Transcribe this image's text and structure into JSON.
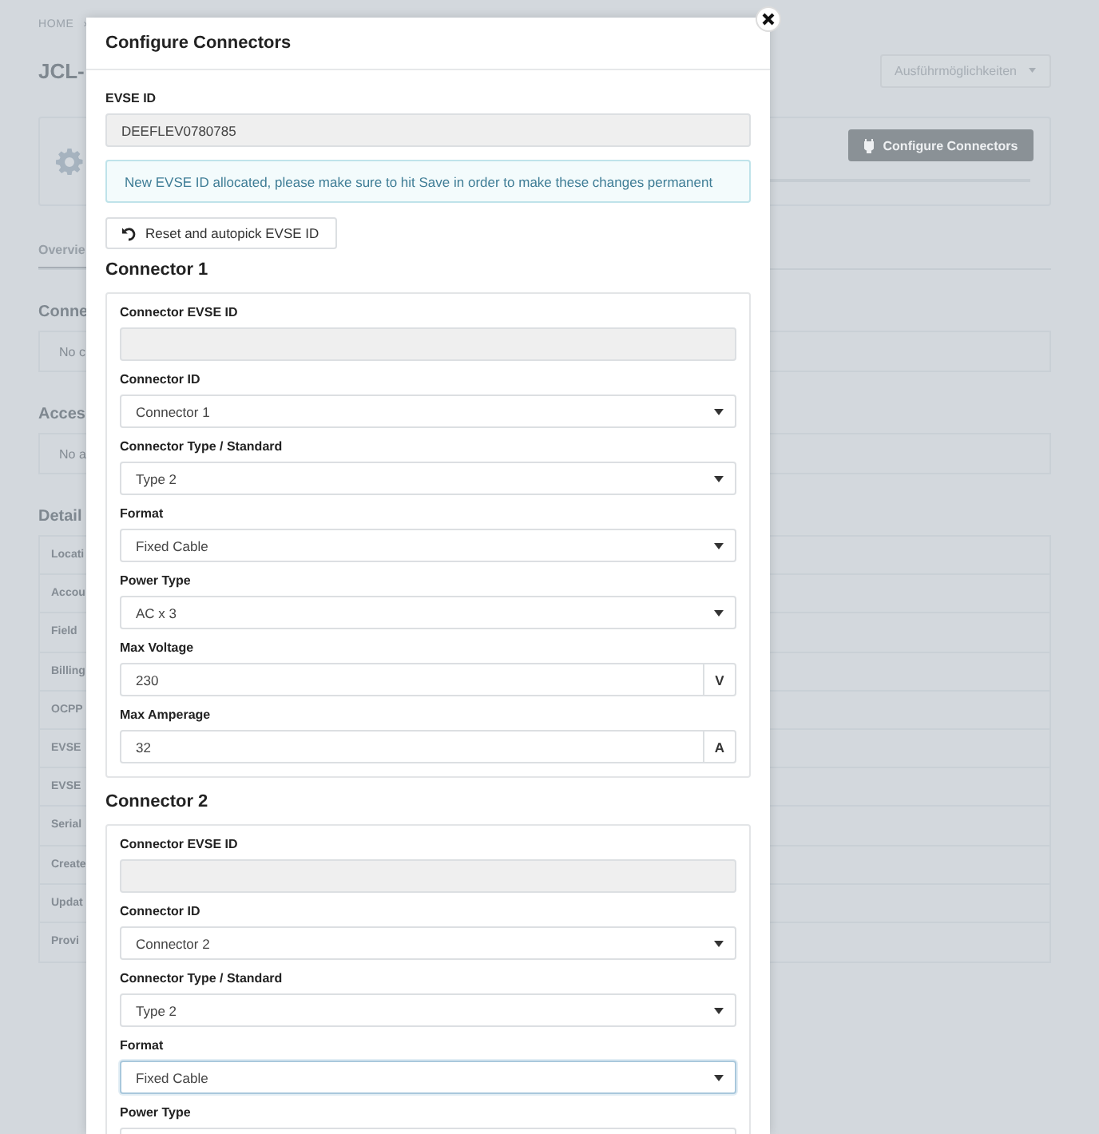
{
  "page": {
    "breadcrumb": [
      "HOME",
      "›"
    ],
    "title": "JCL-",
    "actions_button": "Ausführmöglichkeiten",
    "header_button": "Configure Connectors",
    "tab": "Overvie",
    "sections": [
      {
        "heading": "Conne",
        "empty_text": "No c"
      },
      {
        "heading": "Acces",
        "empty_text": "No a"
      }
    ],
    "details_heading": "Detail",
    "details_rows": [
      "Locati",
      "Accou",
      "Field",
      "Billing",
      "OCPP",
      "EVSE",
      "EVSE",
      "Serial",
      "Create",
      "Updat",
      "Provi"
    ]
  },
  "modal": {
    "title": "Configure Connectors",
    "evse_label": "EVSE ID",
    "evse_value": "DEEFLEV0780785",
    "alert": "New EVSE ID allocated, please make sure to hit Save in order to make these changes permanent",
    "reset_button": "Reset and autopick EVSE ID",
    "connectors": [
      {
        "heading": "Connector 1",
        "fields": [
          {
            "label": "Connector EVSE ID",
            "kind": "readonly",
            "focused": false
          },
          {
            "label": "Connector ID",
            "kind": "select",
            "value": "Connector 1",
            "focused": false
          },
          {
            "label": "Connector Type / Standard",
            "kind": "select",
            "value": "Type 2",
            "focused": false
          },
          {
            "label": "Format",
            "kind": "select",
            "value": "Fixed Cable",
            "focused": false
          },
          {
            "label": "Power Type",
            "kind": "select",
            "value": "AC x 3",
            "focused": false
          },
          {
            "label": "Max Voltage",
            "kind": "unit",
            "value": "230",
            "unit": "V",
            "focused": false
          },
          {
            "label": "Max Amperage",
            "kind": "unit",
            "value": "32",
            "unit": "A",
            "focused": false
          }
        ]
      },
      {
        "heading": "Connector 2",
        "fields": [
          {
            "label": "Connector EVSE ID",
            "kind": "readonly",
            "focused": false
          },
          {
            "label": "Connector ID",
            "kind": "select",
            "value": "Connector 2",
            "focused": false
          },
          {
            "label": "Connector Type / Standard",
            "kind": "select",
            "value": "Type 2",
            "focused": false
          },
          {
            "label": "Format",
            "kind": "select",
            "value": "Fixed Cable",
            "focused": true
          },
          {
            "label": "Power Type",
            "kind": "select",
            "focused": false
          }
        ]
      }
    ]
  }
}
